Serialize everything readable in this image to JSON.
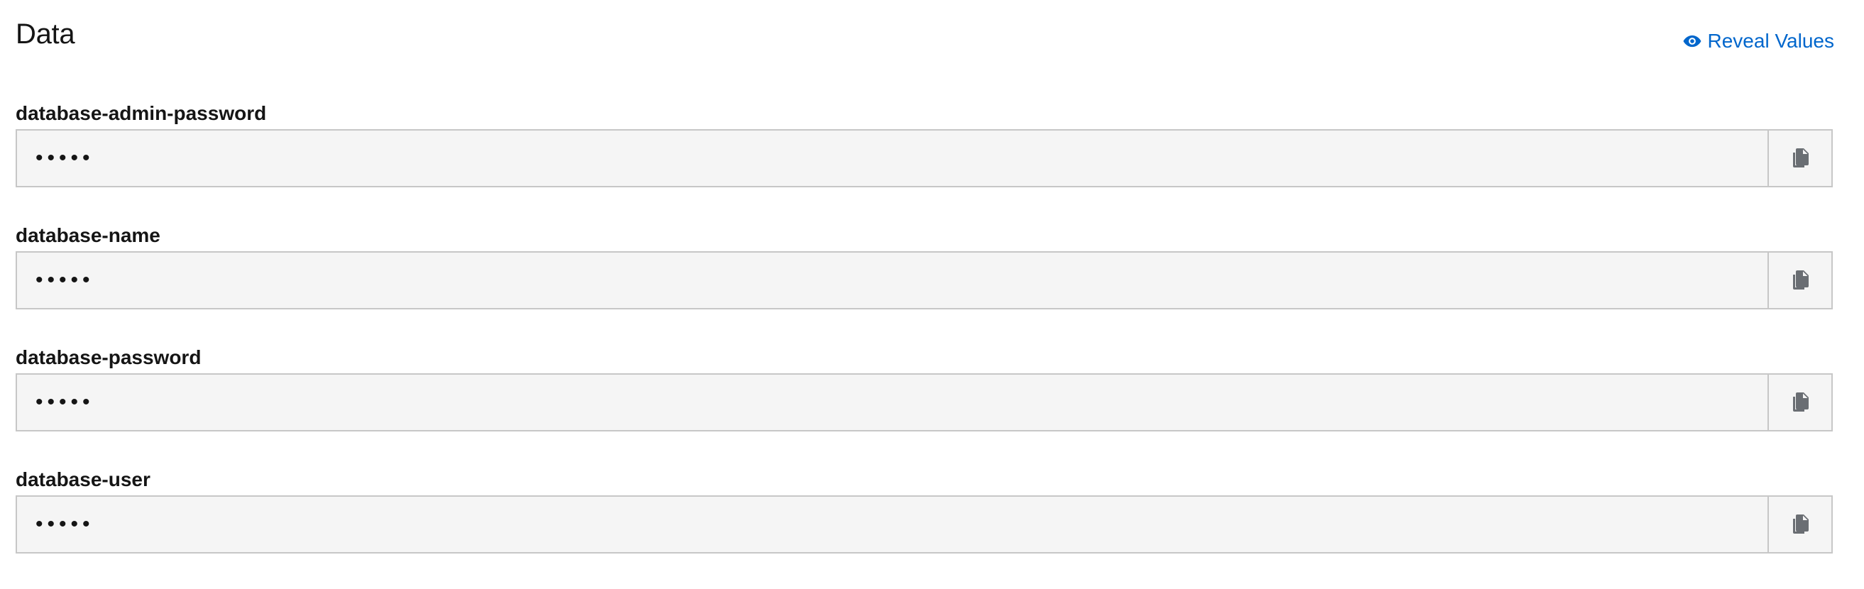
{
  "section": {
    "title": "Data",
    "reveal_label": "Reveal Values",
    "reveal_icon": "eye-icon",
    "accent_color": "#0066cc"
  },
  "fields": [
    {
      "label": "database-admin-password",
      "value": "•••••",
      "action_icon": "copy-icon"
    },
    {
      "label": "database-name",
      "value": "•••••",
      "action_icon": "copy-icon"
    },
    {
      "label": "database-password",
      "value": "•••••",
      "action_icon": "copy-icon"
    },
    {
      "label": "database-user",
      "value": "•••••",
      "action_icon": "copy-icon"
    }
  ]
}
